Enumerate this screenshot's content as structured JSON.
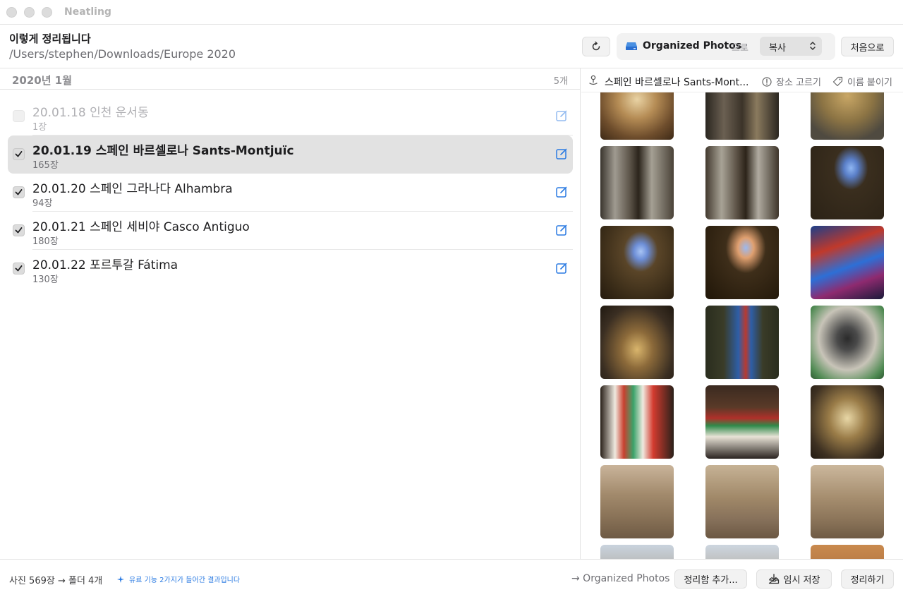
{
  "window": {
    "app_title": "Neatling"
  },
  "header": {
    "title": "이렇게 정리됩니다",
    "path": "/Users/stephen/Downloads/Europe 2020",
    "destination_name": "Organized Photos",
    "destination_suffix": "으로",
    "mode_label": "복사",
    "reset_label": "처음으로"
  },
  "list": {
    "section_title": "2020년 1월",
    "section_count": "5개",
    "rows": [
      {
        "title": "20.01.18 인천 운서동",
        "subtitle": "1장",
        "checked": false
      },
      {
        "title": "20.01.19 스페인 바르셀로나 Sants-Montjuïc",
        "subtitle": "165장",
        "checked": true
      },
      {
        "title": "20.01.20 스페인 그라나다 Alhambra",
        "subtitle": "94장",
        "checked": true
      },
      {
        "title": "20.01.21 스페인 세비야 Casco Antiguo",
        "subtitle": "180장",
        "checked": true
      },
      {
        "title": "20.01.22 포르투갈 Fátima",
        "subtitle": "130장",
        "checked": true
      }
    ]
  },
  "preview": {
    "location_title": "스페인 바르셀로나 Sants-Mont...",
    "pick_place_label": "장소 고르기",
    "name_label": "이름 붙이기",
    "thumbnails": [
      "basilica-dome-ceiling",
      "black-madonna-altar",
      "golden-mosaic-ceiling",
      "black-madonna-silver-altar",
      "black-madonna-silver-altar",
      "rose-window-chapel",
      "rose-window-chapel",
      "rose-window-dark",
      "stained-glass-red-blue",
      "basilica-nave-altar",
      "stained-glass-saint",
      "crucifix-sculpture",
      "votive-candles-colored",
      "votive-candles-rows",
      "basilica-altar-gold",
      "basilica-facade",
      "basilica-facade",
      "basilica-facade",
      "facade-top-sky",
      "facade-top-sky",
      "building-orange"
    ]
  },
  "footer": {
    "summary": "사진 569장 → 폴더 4개",
    "pro_note": "유료 기능 2가지가 들어간 결과입니다",
    "destination_path": "→ Organized Photos",
    "add_label": "정리함 추가...",
    "save_label": "임시 저장",
    "organize_label": "정리하기"
  },
  "colors": {
    "accent": "#2a7ae2",
    "selected_row": "#e2e2e2"
  }
}
